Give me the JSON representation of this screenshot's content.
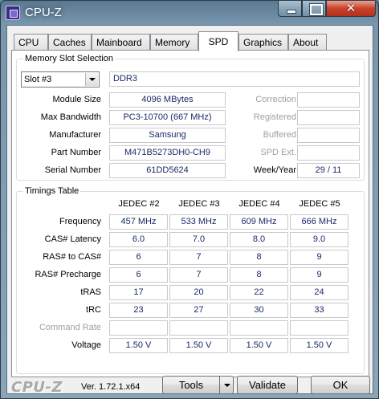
{
  "window": {
    "title": "CPU-Z"
  },
  "tabs": [
    {
      "label": "CPU"
    },
    {
      "label": "Caches"
    },
    {
      "label": "Mainboard"
    },
    {
      "label": "Memory"
    },
    {
      "label": "SPD",
      "active": true
    },
    {
      "label": "Graphics"
    },
    {
      "label": "About"
    }
  ],
  "memory_slot": {
    "group_title": "Memory Slot Selection",
    "slot_selected": "Slot #3",
    "type": "DDR3",
    "left_labels": {
      "module_size": "Module Size",
      "max_bandwidth": "Max Bandwidth",
      "manufacturer": "Manufacturer",
      "part_number": "Part Number",
      "serial_number": "Serial Number"
    },
    "left_values": {
      "module_size": "4096 MBytes",
      "max_bandwidth": "PC3-10700 (667 MHz)",
      "manufacturer": "Samsung",
      "part_number": "M471B5273DH0-CH9",
      "serial_number": "61DD5624"
    },
    "right_labels": {
      "correction": "Correction",
      "registered": "Registered",
      "buffered": "Buffered",
      "spd_ext": "SPD Ext.",
      "week_year": "Week/Year"
    },
    "right_values": {
      "correction": "",
      "registered": "",
      "buffered": "",
      "spd_ext": "",
      "week_year": "29 / 11"
    }
  },
  "timings": {
    "group_title": "Timings Table",
    "columns": [
      "JEDEC #2",
      "JEDEC #3",
      "JEDEC #4",
      "JEDEC #5"
    ],
    "rows": [
      {
        "label": "Frequency",
        "values": [
          "457 MHz",
          "533 MHz",
          "609 MHz",
          "666 MHz"
        ]
      },
      {
        "label": "CAS# Latency",
        "values": [
          "6.0",
          "7.0",
          "8.0",
          "9.0"
        ]
      },
      {
        "label": "RAS# to CAS#",
        "values": [
          "6",
          "7",
          "8",
          "9"
        ]
      },
      {
        "label": "RAS# Precharge",
        "values": [
          "6",
          "7",
          "8",
          "9"
        ]
      },
      {
        "label": "tRAS",
        "values": [
          "17",
          "20",
          "22",
          "24"
        ]
      },
      {
        "label": "tRC",
        "values": [
          "23",
          "27",
          "30",
          "33"
        ]
      },
      {
        "label": "Command Rate",
        "values": [
          "",
          "",
          "",
          ""
        ],
        "disabled": true
      },
      {
        "label": "Voltage",
        "values": [
          "1.50 V",
          "1.50 V",
          "1.50 V",
          "1.50 V"
        ]
      }
    ]
  },
  "footer": {
    "logo": "CPU-Z",
    "version": "Ver. 1.72.1.x64",
    "tools_label": "Tools",
    "validate_label": "Validate",
    "ok_label": "OK"
  }
}
